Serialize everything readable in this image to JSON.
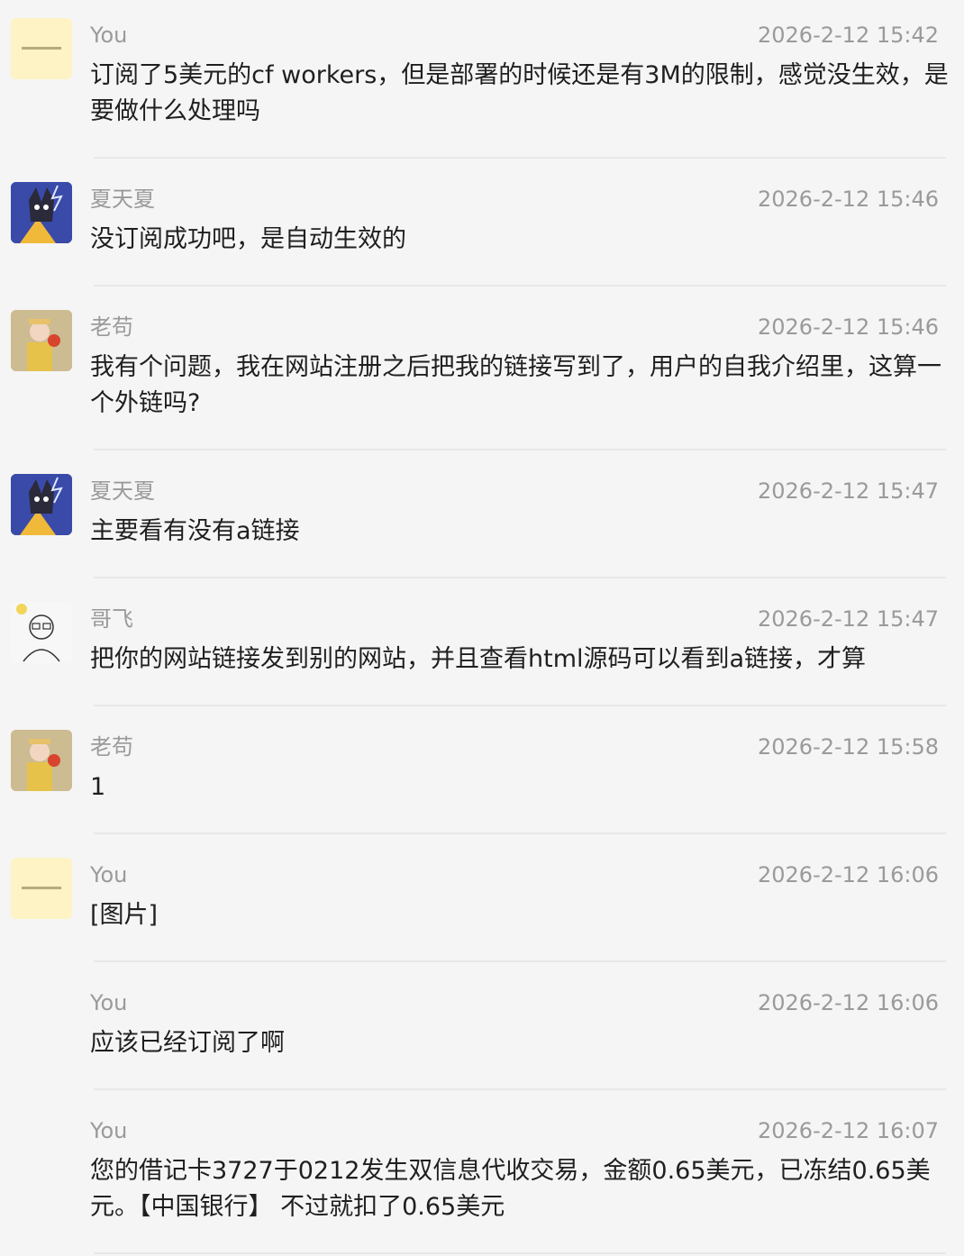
{
  "messages": [
    {
      "sender": "You",
      "time": "2026-2-12 15:42",
      "text": "订阅了5美元的cf workers，但是部署的时候还是有3M的限制，感觉没生效，是要做什么处理吗",
      "avatar": "note-avatar-icon"
    },
    {
      "sender": "夏天夏",
      "time": "2026-2-12 15:46",
      "text": "没订阅成功吧，是自动生效的",
      "avatar": "cartoon-fox-avatar-icon"
    },
    {
      "sender": "老苟",
      "time": "2026-2-12 15:46",
      "text": "我有个问题，我在网站注册之后把我的链接写到了，用户的自我介绍里，这算一个外链吗?",
      "avatar": "child-photo-avatar-icon"
    },
    {
      "sender": "夏天夏",
      "time": "2026-2-12 15:47",
      "text": "主要看有没有a链接",
      "avatar": "cartoon-fox-avatar-icon"
    },
    {
      "sender": "哥飞",
      "time": "2026-2-12 15:47",
      "text": "把你的网站链接发到别的网站，并且查看html源码可以看到a链接，才算",
      "avatar": "bald-man-sketch-avatar-icon"
    },
    {
      "sender": "老苟",
      "time": "2026-2-12 15:58",
      "text": "1",
      "avatar": "child-photo-avatar-icon"
    },
    {
      "sender": "You",
      "time": "2026-2-12 16:06",
      "text": "[图片]",
      "avatar": "note-avatar-icon"
    },
    {
      "sender": "You",
      "time": "2026-2-12 16:06",
      "text": "应该已经订阅了啊",
      "avatar": ""
    },
    {
      "sender": "You",
      "time": "2026-2-12 16:07",
      "text": "您的借记卡3727于0212发生双信息代收交易，金额0.65美元，已冻结0.65美元。【中国银行】 不过就扣了0.65美元",
      "avatar": ""
    }
  ]
}
